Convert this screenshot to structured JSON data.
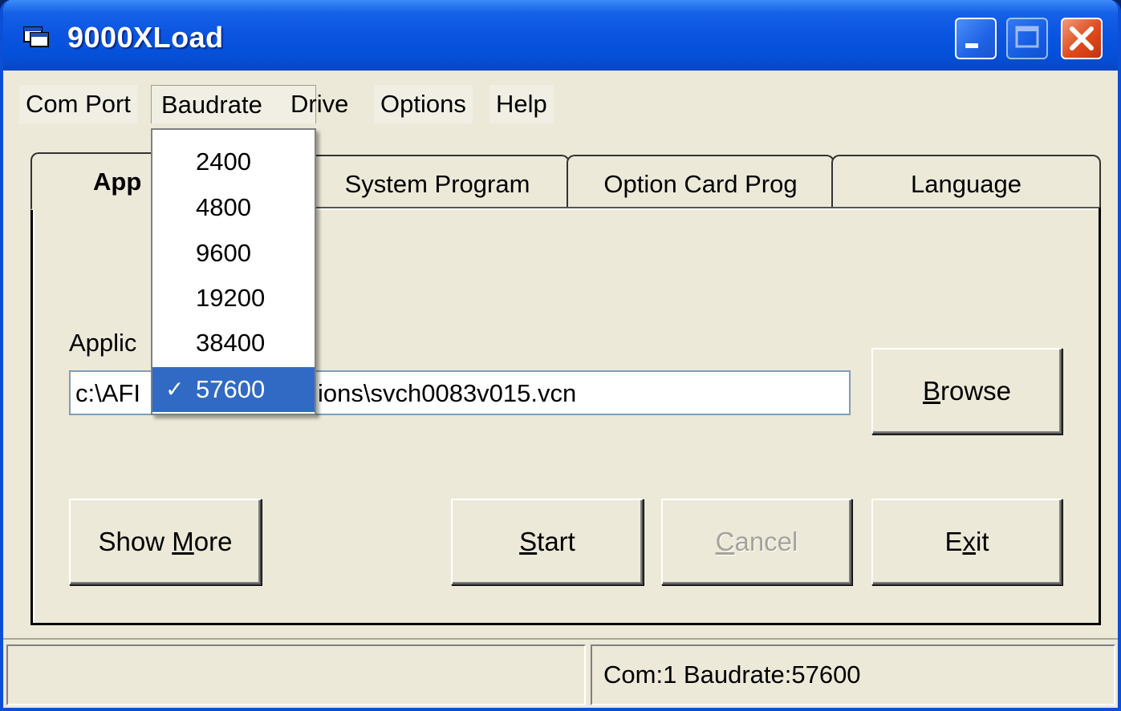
{
  "window": {
    "title": "9000XLoad"
  },
  "menu": {
    "items": [
      "Com Port",
      "Baudrate",
      "Drive",
      "Options",
      "Help"
    ],
    "active": "Baudrate"
  },
  "baudrate_menu": {
    "options": [
      "2400",
      "4800",
      "9600",
      "19200",
      "38400",
      "57600"
    ],
    "selected": "57600"
  },
  "tabs": [
    {
      "label": "App",
      "active": true
    },
    {
      "label": "System Program",
      "active": false
    },
    {
      "label": "Option Card Prog",
      "active": false
    },
    {
      "label": "Language",
      "active": false
    }
  ],
  "main": {
    "field_label": "Applic",
    "path_visible_left": "c:\\AFI",
    "path_visible_right": "ions\\svch0083v015.vcn"
  },
  "buttons": {
    "browse": {
      "pre": "",
      "ul": "B",
      "post": "rowse"
    },
    "show_more": {
      "pre": "Show ",
      "ul": "M",
      "post": "ore"
    },
    "start": {
      "pre": "",
      "ul": "S",
      "post": "tart"
    },
    "cancel": {
      "pre": "",
      "ul": "C",
      "post": "ancel"
    },
    "exit": {
      "pre": "E",
      "ul": "x",
      "post": "it"
    }
  },
  "status": {
    "left": "",
    "right": "Com:1  Baudrate:57600"
  },
  "icons": {
    "app": "app-window-icon",
    "minimize": "minimize-icon",
    "maximize": "maximize-icon",
    "close": "close-icon",
    "check": "checkmark-icon"
  },
  "colors": {
    "titlebar": "#0a54e0",
    "menu_highlight": "#316ac5",
    "face": "#ece9d8"
  }
}
